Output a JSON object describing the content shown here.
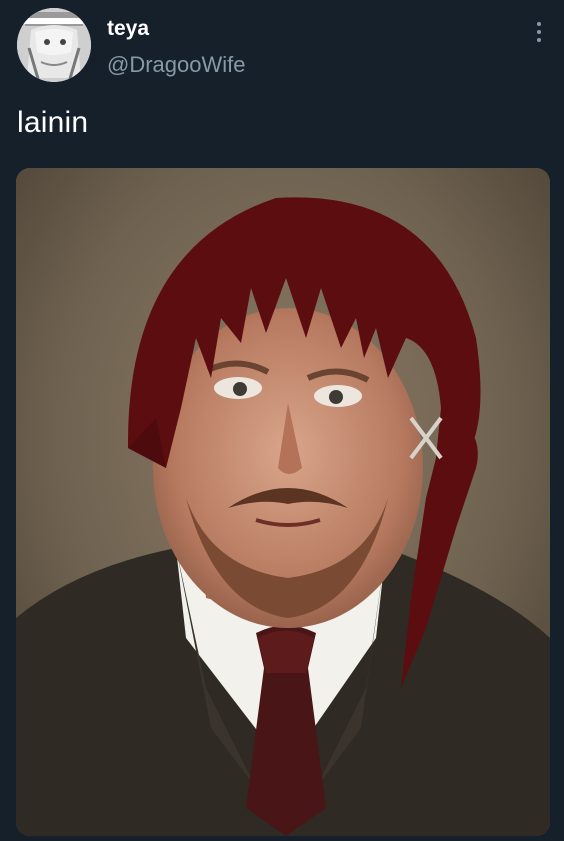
{
  "tweet": {
    "author": {
      "display_name": "teya",
      "handle": "@DragooWife",
      "avatar_icon": "profile-avatar-icon"
    },
    "text": "lainin",
    "more_icon": "vertical-ellipsis-icon",
    "media_icon": "photo-image"
  },
  "colors": {
    "background": "#15202b",
    "name": "#ffffff",
    "handle": "#8899a6",
    "hair": "#5c0d0f"
  }
}
